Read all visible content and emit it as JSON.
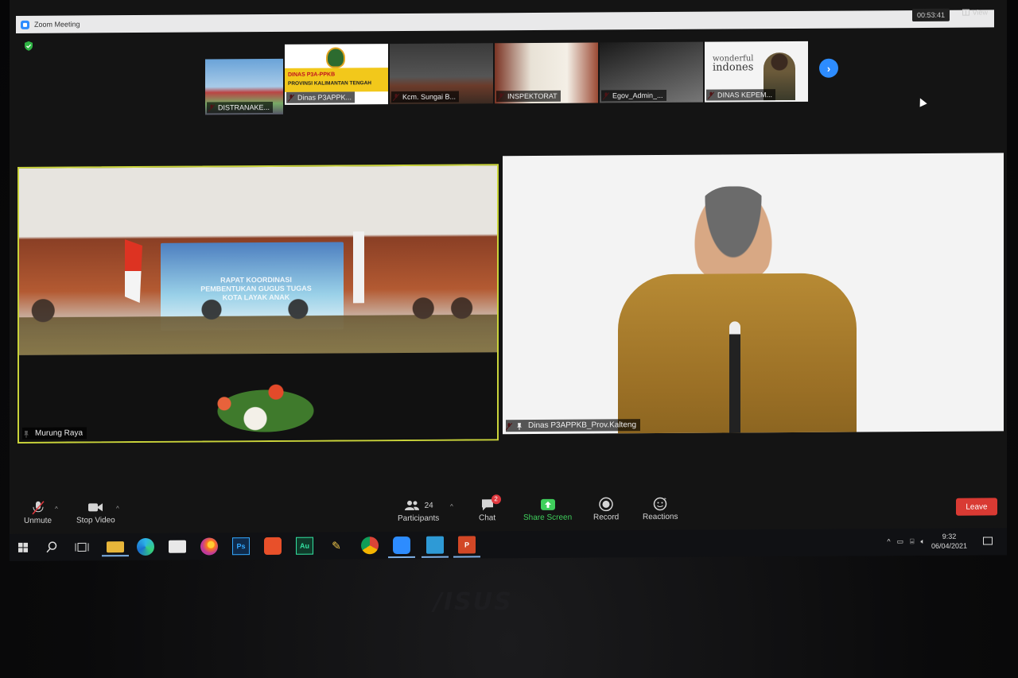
{
  "window": {
    "title": "Zoom Meeting",
    "timer": "00:53:41",
    "view_label": "View"
  },
  "gallery": [
    {
      "name": "DISTRANAKE...",
      "muted": true
    },
    {
      "name": "Dinas P3APPK...",
      "muted": true,
      "banner_line1": "DINAS P3A-PPKB",
      "banner_line2": "PROVINSI KALIMANTAN TENGAH"
    },
    {
      "name": "Kcm. Sungai B...",
      "muted": true
    },
    {
      "name": "INSPEKTORAT",
      "muted": true
    },
    {
      "name": "Egov_Admin_...",
      "muted": true
    },
    {
      "name": "DINAS KEPEM...",
      "muted": true,
      "slogan_top": "wonderful",
      "slogan_bottom": "indones"
    }
  ],
  "main_videos": {
    "left": {
      "name": "Murung Raya",
      "banner_text": "RAPAT KOORDINASI PEMBENTUKAN GUGUS TUGAS KOTA LAYAK ANAK"
    },
    "right": {
      "name": "Dinas P3APPKB_Prov.Kalteng"
    }
  },
  "toolbar": {
    "unmute": "Unmute",
    "stop_video": "Stop Video",
    "participants": "Participants",
    "participants_count": "24",
    "chat": "Chat",
    "chat_badge": "2",
    "share_screen": "Share Screen",
    "record": "Record",
    "reactions": "Reactions",
    "leave": "Leave"
  },
  "taskbar": {
    "time": "9:32",
    "date": "06/04/2021",
    "ps_label": "Ps",
    "au_label": "Au"
  },
  "brand": "/ISUS",
  "colors": {
    "zoom_blue": "#2d8cff",
    "share_green": "#3fcf5c",
    "leave_red": "#d93a33",
    "active_speaker": "#c9d33a"
  }
}
